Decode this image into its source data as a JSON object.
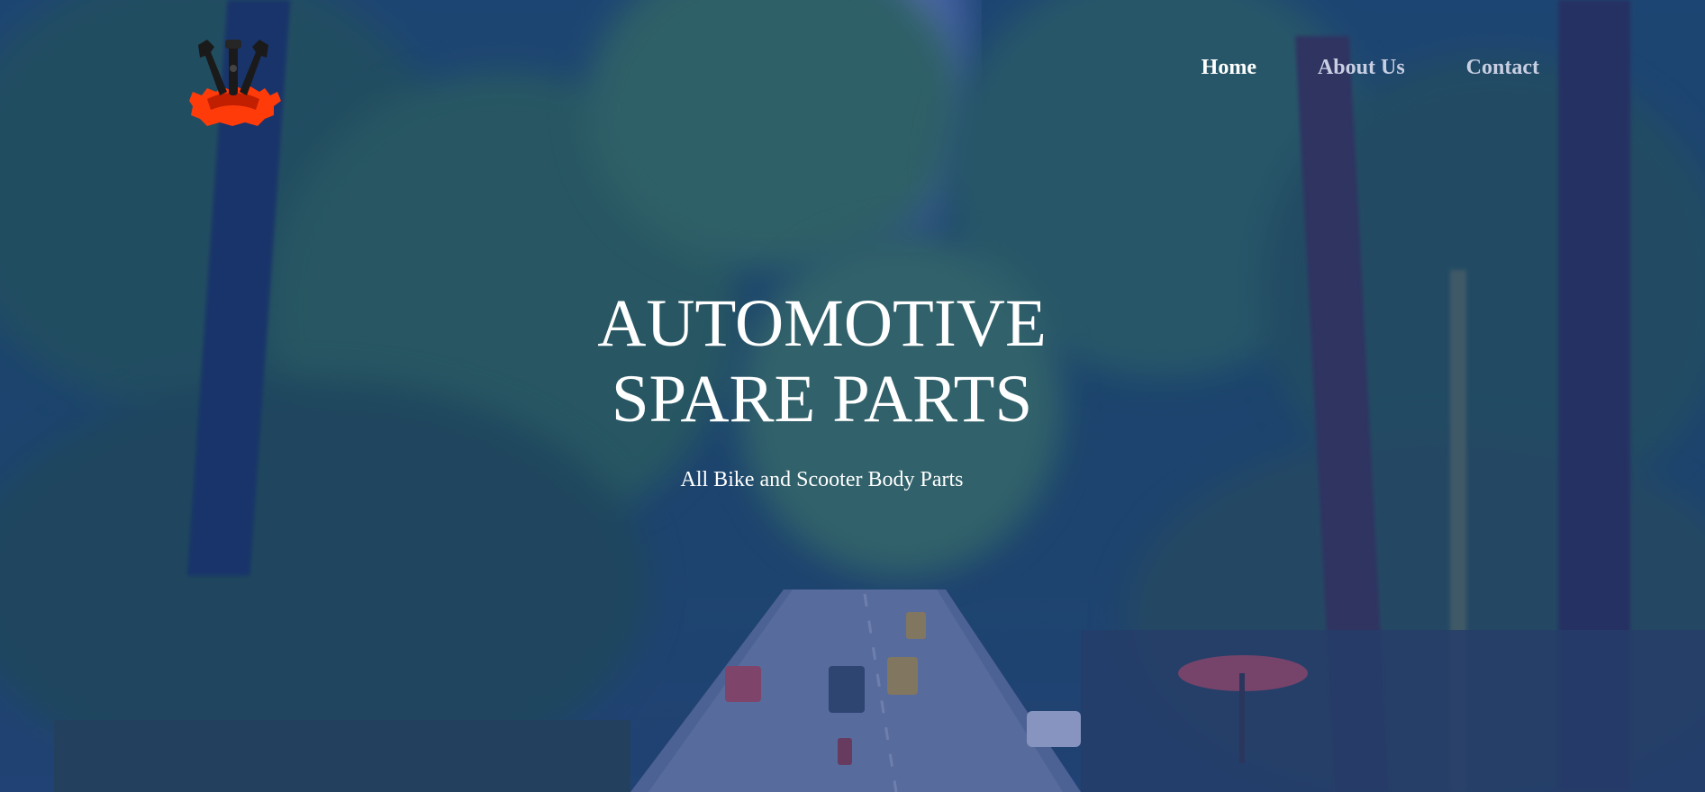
{
  "nav": {
    "items": [
      {
        "label": "Home",
        "active": true
      },
      {
        "label": "About Us",
        "active": false
      },
      {
        "label": "Contact",
        "active": false
      }
    ]
  },
  "hero": {
    "title_line1": "AUTOMOTIVE",
    "title_line2": "SPARE PARTS",
    "subtitle": "All Bike and Scooter Body Parts"
  },
  "colors": {
    "overlay": "#1e3c96",
    "nav_active": "#ffffff",
    "nav_inactive": "#c9cfe3",
    "logo_gear": "#ff3b0a",
    "logo_tools": "#1a1a1a"
  },
  "icons": {
    "logo": "gear-tools-logo"
  }
}
